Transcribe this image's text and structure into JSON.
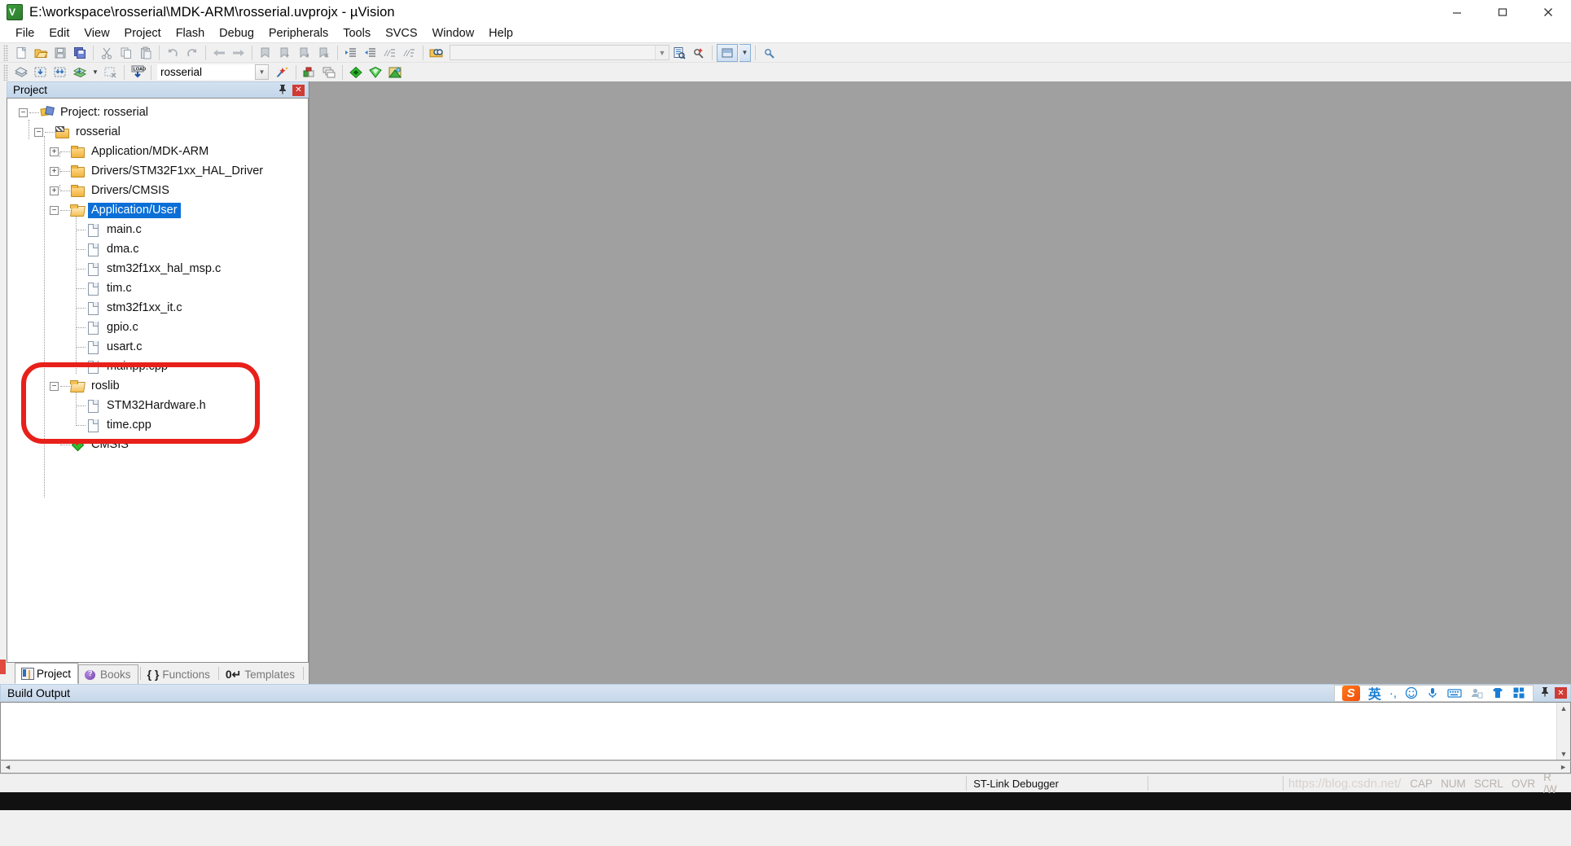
{
  "window": {
    "title": "E:\\workspace\\rosserial\\MDK-ARM\\rosserial.uvprojx - µVision",
    "app_icon": "uvision-icon",
    "minimize_label": "—",
    "maximize_label": "□",
    "close_label": "✕"
  },
  "menu": [
    {
      "label": "File"
    },
    {
      "label": "Edit"
    },
    {
      "label": "View"
    },
    {
      "label": "Project"
    },
    {
      "label": "Flash"
    },
    {
      "label": "Debug"
    },
    {
      "label": "Peripherals"
    },
    {
      "label": "Tools"
    },
    {
      "label": "SVCS"
    },
    {
      "label": "Window"
    },
    {
      "label": "Help"
    }
  ],
  "toolbar_main": {
    "find_box_value": "",
    "find_box_placeholder": "",
    "buttons": [
      "new-file-icon",
      "open-file-icon",
      "save-icon",
      "save-all-icon",
      "cut-icon",
      "copy-icon",
      "paste-icon",
      "undo-icon",
      "redo-icon",
      "navigate-back-icon",
      "navigate-forward-icon",
      "bookmark-toggle-icon",
      "bookmark-prev-icon",
      "bookmark-next-icon",
      "bookmark-clear-icon",
      "indent-icon",
      "outdent-icon",
      "comment-icon",
      "uncomment-icon",
      "find-in-files-icon",
      "browse-symbol-icon",
      "find-symbol-icon",
      "debug-session-icon"
    ]
  },
  "toolbar_build": {
    "target_value": "rosserial",
    "buttons": [
      "translate-icon",
      "build-icon",
      "rebuild-icon",
      "batch-build-icon",
      "batch-build-dropdown-icon",
      "stop-build-icon",
      "download-icon",
      "target-options-icon",
      "manage-run-time-env-icon",
      "multi-project-icon",
      "debug-start-icon",
      "insert-sfr-icon",
      "configure-merge-icon"
    ]
  },
  "project_panel": {
    "title": "Project",
    "pin_icon": "pin-icon",
    "close_icon": "close-icon",
    "tree": [
      {
        "label": "Project: rosserial",
        "icon": "project-icon",
        "level": 0,
        "expander": "-",
        "selected": false
      },
      {
        "label": "rosserial",
        "icon": "project-folder-icon",
        "level": 1,
        "expander": "-",
        "selected": false
      },
      {
        "label": "Application/MDK-ARM",
        "icon": "folder-icon",
        "level": 2,
        "expander": "+",
        "selected": false
      },
      {
        "label": "Drivers/STM32F1xx_HAL_Driver",
        "icon": "folder-icon",
        "level": 2,
        "expander": "+",
        "selected": false
      },
      {
        "label": "Drivers/CMSIS",
        "icon": "folder-icon",
        "level": 2,
        "expander": "+",
        "selected": false
      },
      {
        "label": "Application/User",
        "icon": "folder-open-icon",
        "level": 2,
        "expander": "-",
        "selected": true
      },
      {
        "label": "main.c",
        "icon": "file-icon",
        "level": 3,
        "expander": "",
        "selected": false
      },
      {
        "label": "dma.c",
        "icon": "file-icon",
        "level": 3,
        "expander": "",
        "selected": false
      },
      {
        "label": "stm32f1xx_hal_msp.c",
        "icon": "file-icon",
        "level": 3,
        "expander": "",
        "selected": false
      },
      {
        "label": "tim.c",
        "icon": "file-icon",
        "level": 3,
        "expander": "",
        "selected": false
      },
      {
        "label": "stm32f1xx_it.c",
        "icon": "file-icon",
        "level": 3,
        "expander": "",
        "selected": false
      },
      {
        "label": "gpio.c",
        "icon": "file-icon",
        "level": 3,
        "expander": "",
        "selected": false
      },
      {
        "label": "usart.c",
        "icon": "file-icon",
        "level": 3,
        "expander": "",
        "selected": false
      },
      {
        "label": "mainpp.cpp",
        "icon": "file-icon",
        "level": 3,
        "expander": "",
        "selected": false
      },
      {
        "label": "roslib",
        "icon": "folder-open-icon",
        "level": 2,
        "expander": "-",
        "selected": false
      },
      {
        "label": "STM32Hardware.h",
        "icon": "file-icon",
        "level": 3,
        "expander": "",
        "selected": false
      },
      {
        "label": "time.cpp",
        "icon": "file-icon",
        "level": 3,
        "expander": "",
        "selected": false
      },
      {
        "label": "CMSIS",
        "icon": "cmsis-icon",
        "level": 2,
        "expander": "",
        "selected": false
      }
    ],
    "annotation_color": "#e8201a"
  },
  "bottom_tabs": [
    {
      "label": "Project",
      "icon": "project-tab-icon",
      "active": true
    },
    {
      "label": "Books",
      "icon": "books-tab-icon",
      "active": false
    },
    {
      "label": "Functions",
      "icon": "functions-tab-icon",
      "glyph": "{ }",
      "active": false
    },
    {
      "label": "Templates",
      "icon": "templates-tab-icon",
      "glyph": "0↵",
      "active": false
    }
  ],
  "build_output": {
    "title": "Build Output",
    "content": "",
    "pin_icon": "pin-icon",
    "close_icon": "close-icon",
    "ime": {
      "logo": "sogou-logo",
      "mode_label": "英",
      "icons": [
        "punctuation-icon",
        "emoji-icon",
        "voice-input-icon",
        "soft-keyboard-icon",
        "user-icon",
        "skin-icon",
        "toolbox-icon"
      ]
    }
  },
  "statusbar": {
    "debugger": "ST-Link Debugger",
    "watermark": "https://blog.csdn.net/",
    "flags": [
      "CAP",
      "NUM",
      "SCRL",
      "OVR",
      "R /W"
    ]
  }
}
